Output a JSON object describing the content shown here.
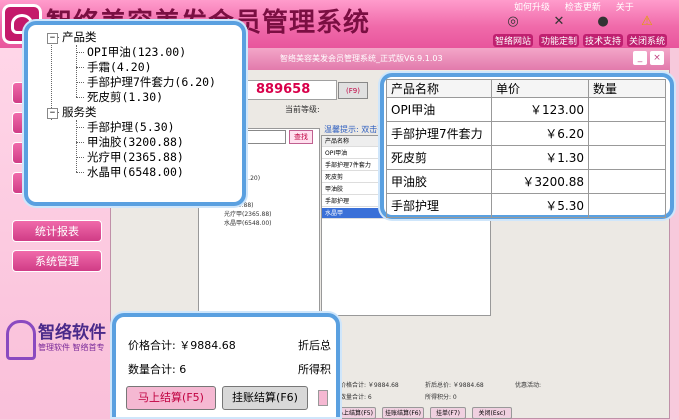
{
  "app": {
    "title": "智络美容美发会员管理系统",
    "top_links": [
      "如何升级",
      "检查更新",
      "关于"
    ],
    "window_title": "智络美容美发会员管理系统_正式版V6.9.1.03"
  },
  "toolbar": [
    {
      "icon": "globe-icon",
      "label": "智络网站"
    },
    {
      "icon": "tools-icon",
      "label": "功能定制"
    },
    {
      "icon": "qq-icon",
      "label": "技术支持"
    },
    {
      "icon": "warning-icon",
      "label": "关闭系统"
    }
  ],
  "sidebar": {
    "items": [
      "统计报表",
      "系统管理"
    ],
    "brand_name": "智络软件",
    "brand_sub": "管理软件 智络首专"
  },
  "form": {
    "card_no": "889658",
    "card_button": "(F9)",
    "level_label": "当前等级:",
    "search_button": "查找",
    "hint": "温馨提示: 双击列表",
    "list_header": "产品名称"
  },
  "bg_tree": [
    "123.00)",
    ")",
    "件套力(6.20)",
    ")",
    "(5.30)",
    "(3200.88)",
    "光疗甲(2365.88)",
    "水晶甲(6548.00)"
  ],
  "bg_list": [
    "OPI甲油",
    "手部护理7件套力",
    "死皮剪",
    "甲油胶",
    "手部护理",
    "水晶甲"
  ],
  "bg_bottom": {
    "price_total": "价格合计: ￥9884.68",
    "qty_total": "数量合计: 6",
    "after_discount": "折后总价: ￥9884.68",
    "points": "所得积分: 0",
    "promo": "优惠活动:",
    "buttons": [
      "马上结算(F5)",
      "挂账结算(F6)",
      "挂单(F7)",
      "关闭(Esc)"
    ]
  },
  "tree_callout": {
    "categories": [
      {
        "name": "产品类",
        "items": [
          "OPI甲油(123.00)",
          "手霜(4.20)",
          "手部护理7件套力(6.20)",
          "死皮剪(1.30)"
        ]
      },
      {
        "name": "服务类",
        "items": [
          "手部护理(5.30)",
          "甲油胶(3200.88)",
          "光疗甲(2365.88)",
          "水晶甲(6548.00)"
        ]
      }
    ]
  },
  "table_callout": {
    "headers": [
      "产品名称",
      "单价",
      "数量"
    ],
    "rows": [
      {
        "name": "OPI甲油",
        "price": "￥123.00",
        "qty": ""
      },
      {
        "name": "手部护理7件套力",
        "price": "￥6.20",
        "qty": ""
      },
      {
        "name": "死皮剪",
        "price": "￥1.30",
        "qty": ""
      },
      {
        "name": "甲油胶",
        "price": "￥3200.88",
        "qty": ""
      },
      {
        "name": "手部护理",
        "price": "￥5.30",
        "qty": ""
      }
    ]
  },
  "summary_callout": {
    "price_total": "价格合计: ￥9884.68",
    "qty_total": "数量合计: 6",
    "after_discount_partial": "折后总",
    "points_partial": "所得积",
    "checkout_button": "马上结算(F5)",
    "credit_button": "挂账结算(F6)"
  }
}
